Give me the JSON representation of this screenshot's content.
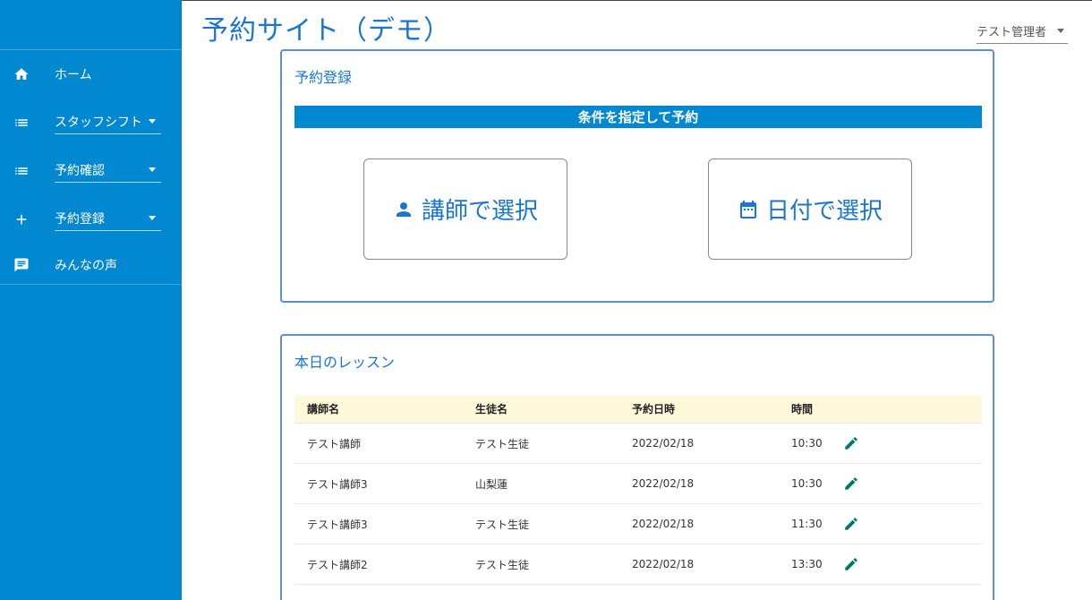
{
  "app": {
    "title": "予約サイト（デモ）"
  },
  "user_menu": {
    "name": "テスト管理者"
  },
  "sidebar": {
    "items": [
      {
        "label": "ホーム",
        "icon": "home-icon",
        "type": "link"
      },
      {
        "label": "スタッフシフト",
        "icon": "list-icon",
        "type": "select"
      },
      {
        "label": "予約確認",
        "icon": "list-icon",
        "type": "select"
      },
      {
        "label": "予約登録",
        "icon": "plus-icon",
        "type": "select"
      },
      {
        "label": "みんなの声",
        "icon": "chat-icon",
        "type": "link"
      }
    ]
  },
  "reserve": {
    "title": "予約登録",
    "banner": "条件を指定して予約",
    "teacher_button": "講師で選択",
    "date_button": "日付で選択"
  },
  "lessons": {
    "title": "本日のレッスン",
    "columns": [
      "講師名",
      "生徒名",
      "予約日時",
      "時間"
    ],
    "rows": [
      {
        "teacher": "テスト講師",
        "student": "テスト生徒",
        "date": "2022/02/18",
        "time": "10:30"
      },
      {
        "teacher": "テスト講師3",
        "student": "山梨蓮",
        "date": "2022/02/18",
        "time": "10:30"
      },
      {
        "teacher": "テスト講師3",
        "student": "テスト生徒",
        "date": "2022/02/18",
        "time": "11:30"
      },
      {
        "teacher": "テスト講師2",
        "student": "テスト生徒",
        "date": "2022/02/18",
        "time": "13:30"
      }
    ]
  },
  "colors": {
    "sidebar": "#0288d1",
    "accent": "#1976d2",
    "card_border": "#5b8de0",
    "table_header": "#fff9db",
    "edit_icon": "#00796b"
  }
}
